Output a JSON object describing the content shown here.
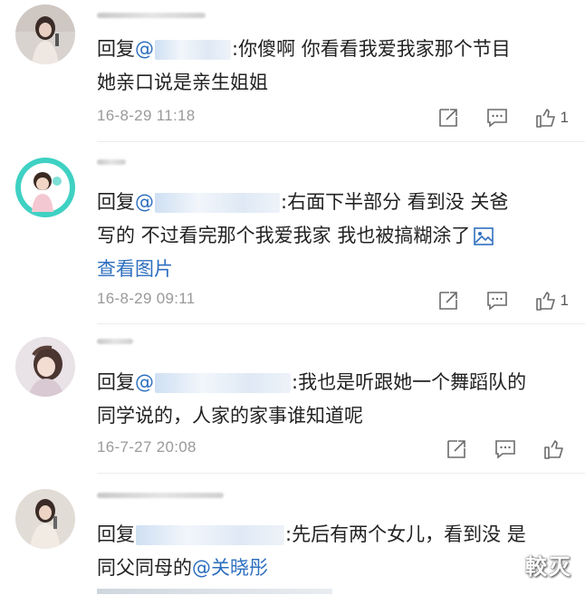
{
  "comments": [
    {
      "reply_prefix": "回复",
      "mention_symbol": "@",
      "text_line1": ":你傻啊 你看看我爱我家那个节目",
      "text_line2": "她亲口说是亲生姐姐",
      "time": "16-8-29 11:18",
      "like_count": "1"
    },
    {
      "reply_prefix": "回复",
      "mention_symbol": "@",
      "text_line1": ":右面下半部分 看到没 关爸",
      "text_line2": "写的 不过看完那个我爱我家 我也被搞糊涂了",
      "view_image": "查看图片",
      "time": "16-8-29 09:11",
      "like_count": "1"
    },
    {
      "reply_prefix": "回复",
      "mention_symbol": "@",
      "text_line1": ":我也是听跟她一个舞蹈队的",
      "text_line2": "同学说的，人家的家事谁知道呢",
      "time": "16-7-27 20:08",
      "like_count": ""
    },
    {
      "reply_prefix": "回复",
      "mention_symbol": "",
      "text_line1": ":先后有两个女儿，看到没 是",
      "text_line2_prefix": "同父同母的",
      "text_line2_mention": "@关晓彤",
      "time": "",
      "like_count": ""
    }
  ],
  "icons": {
    "share": "share-icon",
    "comment": "comment-icon",
    "like": "thumbs-up-icon",
    "image": "image-icon"
  },
  "colors": {
    "link": "#2e6fbf",
    "time": "#9a9a9a",
    "icon": "#6b6b6b"
  },
  "watermark": "較灭"
}
